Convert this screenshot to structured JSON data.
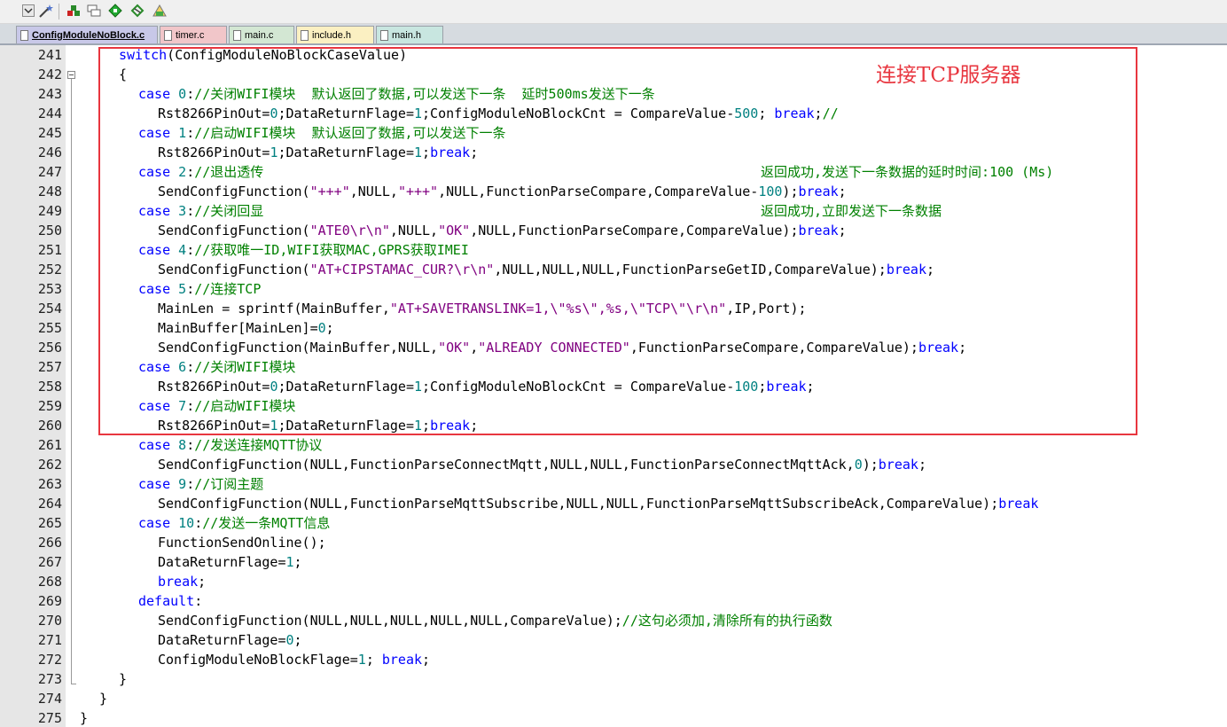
{
  "toolbar": {
    "buttons": [
      {
        "name": "dropdown-icon"
      },
      {
        "name": "wand-icon"
      },
      {
        "name": "build-icon"
      },
      {
        "name": "window-icon"
      },
      {
        "name": "diamond-icon"
      },
      {
        "name": "debug-icon"
      },
      {
        "name": "settings-icon"
      }
    ]
  },
  "tabs": [
    {
      "label": "ConfigModuleNoBlock.c",
      "color": "#c8c8e8",
      "active": true
    },
    {
      "label": "timer.c",
      "color": "#f1c6c9",
      "active": false
    },
    {
      "label": "main.c",
      "color": "#d3e7d3",
      "active": false
    },
    {
      "label": "include.h",
      "color": "#fbf0c2",
      "active": false
    },
    {
      "label": "main.h",
      "color": "#c8e6e0",
      "active": false
    }
  ],
  "annotation": {
    "text": "连接TCP服务器",
    "color": "#e8363f"
  },
  "side_comments": {
    "line247": "返回成功,发送下一条数据的延时时间:100 (Ms)",
    "line249": "返回成功,立即发送下一条数据"
  },
  "lines": [
    {
      "n": "241",
      "indent": 2,
      "t": [
        [
          "kw",
          "switch"
        ],
        [
          "plain",
          "(ConfigModuleNoBlockCaseValue)"
        ]
      ]
    },
    {
      "n": "242",
      "indent": 2,
      "t": [
        [
          "plain",
          "{"
        ]
      ]
    },
    {
      "n": "243",
      "indent": 3,
      "t": [
        [
          "kw",
          "case "
        ],
        [
          "num",
          "0"
        ],
        [
          "plain",
          ":"
        ],
        [
          "cmt",
          "//关闭WIFI模块  默认返回了数据,可以发送下一条  延时500ms发送下一条"
        ]
      ]
    },
    {
      "n": "244",
      "indent": 4,
      "t": [
        [
          "plain",
          "Rst8266PinOut="
        ],
        [
          "num",
          "0"
        ],
        [
          "plain",
          ";DataReturnFlage="
        ],
        [
          "num",
          "1"
        ],
        [
          "plain",
          ";ConfigModuleNoBlockCnt = CompareValue-"
        ],
        [
          "num",
          "500"
        ],
        [
          "plain",
          "; "
        ],
        [
          "kw",
          "break"
        ],
        [
          "plain",
          ";"
        ],
        [
          "cmt",
          "//"
        ]
      ]
    },
    {
      "n": "245",
      "indent": 3,
      "t": [
        [
          "kw",
          "case "
        ],
        [
          "num",
          "1"
        ],
        [
          "plain",
          ":"
        ],
        [
          "cmt",
          "//启动WIFI模块  默认返回了数据,可以发送下一条"
        ]
      ]
    },
    {
      "n": "246",
      "indent": 4,
      "t": [
        [
          "plain",
          "Rst8266PinOut="
        ],
        [
          "num",
          "1"
        ],
        [
          "plain",
          ";DataReturnFlage="
        ],
        [
          "num",
          "1"
        ],
        [
          "plain",
          ";"
        ],
        [
          "kw",
          "break"
        ],
        [
          "plain",
          ";"
        ]
      ]
    },
    {
      "n": "247",
      "indent": 3,
      "t": [
        [
          "kw",
          "case "
        ],
        [
          "num",
          "2"
        ],
        [
          "plain",
          ":"
        ],
        [
          "cmt",
          "//退出透传"
        ]
      ]
    },
    {
      "n": "248",
      "indent": 4,
      "t": [
        [
          "plain",
          "SendConfigFunction("
        ],
        [
          "str",
          "\"+++\""
        ],
        [
          "plain",
          ",NULL,"
        ],
        [
          "str",
          "\"+++\""
        ],
        [
          "plain",
          ",NULL,FunctionParseCompare,CompareValue-"
        ],
        [
          "num",
          "100"
        ],
        [
          "plain",
          ");"
        ],
        [
          "kw",
          "break"
        ],
        [
          "plain",
          ";"
        ]
      ]
    },
    {
      "n": "249",
      "indent": 3,
      "t": [
        [
          "kw",
          "case "
        ],
        [
          "num",
          "3"
        ],
        [
          "plain",
          ":"
        ],
        [
          "cmt",
          "//关闭回显"
        ]
      ]
    },
    {
      "n": "250",
      "indent": 4,
      "t": [
        [
          "plain",
          "SendConfigFunction("
        ],
        [
          "str",
          "\"ATE0\\r\\n\""
        ],
        [
          "plain",
          ",NULL,"
        ],
        [
          "str",
          "\"OK\""
        ],
        [
          "plain",
          ",NULL,FunctionParseCompare,CompareValue);"
        ],
        [
          "kw",
          "break"
        ],
        [
          "plain",
          ";"
        ]
      ]
    },
    {
      "n": "251",
      "indent": 3,
      "t": [
        [
          "kw",
          "case "
        ],
        [
          "num",
          "4"
        ],
        [
          "plain",
          ":"
        ],
        [
          "cmt",
          "//获取唯一ID,WIFI获取MAC,GPRS获取IMEI"
        ]
      ]
    },
    {
      "n": "252",
      "indent": 4,
      "t": [
        [
          "plain",
          "SendConfigFunction("
        ],
        [
          "str",
          "\"AT+CIPSTAMAC_CUR?\\r\\n\""
        ],
        [
          "plain",
          ",NULL,NULL,NULL,FunctionParseGetID,CompareValue);"
        ],
        [
          "kw",
          "break"
        ],
        [
          "plain",
          ";"
        ]
      ]
    },
    {
      "n": "253",
      "indent": 3,
      "t": [
        [
          "kw",
          "case "
        ],
        [
          "num",
          "5"
        ],
        [
          "plain",
          ":"
        ],
        [
          "cmt",
          "//连接TCP"
        ]
      ]
    },
    {
      "n": "254",
      "indent": 4,
      "t": [
        [
          "plain",
          "MainLen = sprintf(MainBuffer,"
        ],
        [
          "str",
          "\"AT+SAVETRANSLINK=1,\\\"%s\\\",%s,\\\"TCP\\\"\\r\\n\""
        ],
        [
          "plain",
          ",IP,Port);"
        ]
      ]
    },
    {
      "n": "255",
      "indent": 4,
      "t": [
        [
          "plain",
          "MainBuffer[MainLen]="
        ],
        [
          "num",
          "0"
        ],
        [
          "plain",
          ";"
        ]
      ]
    },
    {
      "n": "256",
      "indent": 4,
      "t": [
        [
          "plain",
          "SendConfigFunction(MainBuffer,NULL,"
        ],
        [
          "str",
          "\"OK\""
        ],
        [
          "plain",
          ","
        ],
        [
          "str",
          "\"ALREADY CONNECTED\""
        ],
        [
          "plain",
          ",FunctionParseCompare,CompareValue);"
        ],
        [
          "kw",
          "break"
        ],
        [
          "plain",
          ";"
        ]
      ]
    },
    {
      "n": "257",
      "indent": 3,
      "t": [
        [
          "kw",
          "case "
        ],
        [
          "num",
          "6"
        ],
        [
          "plain",
          ":"
        ],
        [
          "cmt",
          "//关闭WIFI模块"
        ]
      ]
    },
    {
      "n": "258",
      "indent": 4,
      "t": [
        [
          "plain",
          "Rst8266PinOut="
        ],
        [
          "num",
          "0"
        ],
        [
          "plain",
          ";DataReturnFlage="
        ],
        [
          "num",
          "1"
        ],
        [
          "plain",
          ";ConfigModuleNoBlockCnt = CompareValue-"
        ],
        [
          "num",
          "100"
        ],
        [
          "plain",
          ";"
        ],
        [
          "kw",
          "break"
        ],
        [
          "plain",
          ";"
        ]
      ]
    },
    {
      "n": "259",
      "indent": 3,
      "t": [
        [
          "kw",
          "case "
        ],
        [
          "num",
          "7"
        ],
        [
          "plain",
          ":"
        ],
        [
          "cmt",
          "//启动WIFI模块"
        ]
      ]
    },
    {
      "n": "260",
      "indent": 4,
      "t": [
        [
          "plain",
          "Rst8266PinOut="
        ],
        [
          "num",
          "1"
        ],
        [
          "plain",
          ";DataReturnFlage="
        ],
        [
          "num",
          "1"
        ],
        [
          "plain",
          ";"
        ],
        [
          "kw",
          "break"
        ],
        [
          "plain",
          ";"
        ]
      ]
    },
    {
      "n": "261",
      "indent": 3,
      "t": [
        [
          "kw",
          "case "
        ],
        [
          "num",
          "8"
        ],
        [
          "plain",
          ":"
        ],
        [
          "cmt",
          "//发送连接MQTT协议"
        ]
      ]
    },
    {
      "n": "262",
      "indent": 4,
      "t": [
        [
          "plain",
          "SendConfigFunction(NULL,FunctionParseConnectMqtt,NULL,NULL,FunctionParseConnectMqttAck,"
        ],
        [
          "num",
          "0"
        ],
        [
          "plain",
          ");"
        ],
        [
          "kw",
          "break"
        ],
        [
          "plain",
          ";"
        ]
      ]
    },
    {
      "n": "263",
      "indent": 3,
      "t": [
        [
          "kw",
          "case "
        ],
        [
          "num",
          "9"
        ],
        [
          "plain",
          ":"
        ],
        [
          "cmt",
          "//订阅主题"
        ]
      ]
    },
    {
      "n": "264",
      "indent": 4,
      "t": [
        [
          "plain",
          "SendConfigFunction(NULL,FunctionParseMqttSubscribe,NULL,NULL,FunctionParseMqttSubscribeAck,CompareValue);"
        ],
        [
          "kw",
          "break"
        ]
      ]
    },
    {
      "n": "265",
      "indent": 3,
      "t": [
        [
          "kw",
          "case "
        ],
        [
          "num",
          "10"
        ],
        [
          "plain",
          ":"
        ],
        [
          "cmt",
          "//发送一条MQTT信息"
        ]
      ]
    },
    {
      "n": "266",
      "indent": 4,
      "t": [
        [
          "plain",
          "FunctionSendOnline();"
        ]
      ]
    },
    {
      "n": "267",
      "indent": 4,
      "t": [
        [
          "plain",
          "DataReturnFlage="
        ],
        [
          "num",
          "1"
        ],
        [
          "plain",
          ";"
        ]
      ]
    },
    {
      "n": "268",
      "indent": 4,
      "t": [
        [
          "kw",
          "break"
        ],
        [
          "plain",
          ";"
        ]
      ]
    },
    {
      "n": "269",
      "indent": 3,
      "t": [
        [
          "kw",
          "default"
        ],
        [
          "plain",
          ":"
        ]
      ]
    },
    {
      "n": "270",
      "indent": 4,
      "t": [
        [
          "plain",
          "SendConfigFunction(NULL,NULL,NULL,NULL,NULL,CompareValue);"
        ],
        [
          "cmt",
          "//这句必须加,清除所有的执行函数"
        ]
      ]
    },
    {
      "n": "271",
      "indent": 4,
      "t": [
        [
          "plain",
          "DataReturnFlage="
        ],
        [
          "num",
          "0"
        ],
        [
          "plain",
          ";"
        ]
      ]
    },
    {
      "n": "272",
      "indent": 4,
      "t": [
        [
          "plain",
          "ConfigModuleNoBlockFlage="
        ],
        [
          "num",
          "1"
        ],
        [
          "plain",
          "; "
        ],
        [
          "kw",
          "break"
        ],
        [
          "plain",
          ";"
        ]
      ]
    },
    {
      "n": "273",
      "indent": 2,
      "t": [
        [
          "plain",
          "}"
        ]
      ]
    },
    {
      "n": "274",
      "indent": 1,
      "t": [
        [
          "plain",
          "}"
        ]
      ]
    },
    {
      "n": "275",
      "indent": 0,
      "t": [
        [
          "plain",
          "}"
        ]
      ]
    }
  ]
}
